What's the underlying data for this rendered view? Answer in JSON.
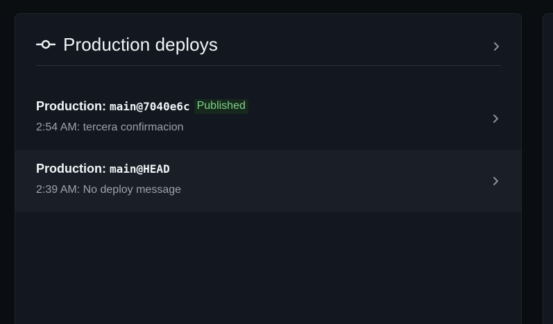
{
  "panel": {
    "title": "Production deploys",
    "icon": "commit-icon",
    "accent_color": "#f2f4f7"
  },
  "deploys": [
    {
      "environment": "Production:",
      "ref": "main@7040e6c",
      "badge": "Published",
      "badge_color": "#7fd18a",
      "time": "2:54 AM:",
      "message": "tercera confirmacion"
    },
    {
      "environment": "Production:",
      "ref": "main@HEAD",
      "badge": "",
      "time": "2:39 AM:",
      "message": "No deploy message"
    }
  ]
}
